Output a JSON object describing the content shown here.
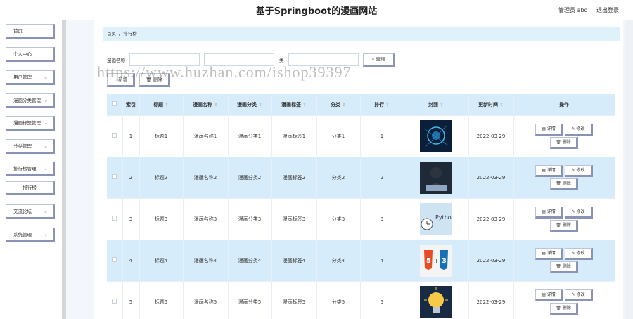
{
  "header": {
    "title": "基于Springboot的漫画网站",
    "user": "管理员 abo",
    "logout": "退出登录"
  },
  "sidebar": {
    "items": [
      {
        "label": "首页",
        "has_chevron": false
      },
      {
        "label": "个人中心",
        "has_chevron": false
      },
      {
        "label": "用户管理",
        "has_chevron": true
      },
      {
        "label": "漫画分类管理",
        "has_chevron": true
      },
      {
        "label": "漫画标签管理",
        "has_chevron": true
      },
      {
        "label": "分类管理",
        "has_chevron": true
      },
      {
        "label": "排行榜管理",
        "has_chevron": true
      },
      {
        "label": "排行榜",
        "sub": true
      },
      {
        "label": "交流论坛",
        "has_chevron": true
      },
      {
        "label": "系统管理",
        "has_chevron": true
      }
    ]
  },
  "breadcrumb": {
    "home": "首页",
    "sep": "/",
    "current": "排行榜"
  },
  "search": {
    "label1": "漫画名称",
    "label2": "类",
    "button": "查询"
  },
  "actions": {
    "add": "+ 新增",
    "delete": "删除"
  },
  "table": {
    "headers": [
      "",
      "索引",
      "标题",
      "漫画名称",
      "漫画分类",
      "漫画标签",
      "分类",
      "排行",
      "封面",
      "更新时间",
      "操作"
    ],
    "rows": [
      {
        "index": "1",
        "title": "标题1",
        "name": "漫画名称1",
        "category": "漫画分类1",
        "tag": "漫画标签1",
        "class": "分类1",
        "rank": "1",
        "date": "2022-03-29",
        "cover": "ai-brain"
      },
      {
        "index": "2",
        "title": "标题2",
        "name": "漫画名称2",
        "category": "漫画分类2",
        "tag": "漫画标签2",
        "class": "分类2",
        "rank": "2",
        "date": "2022-03-29",
        "cover": "hacker"
      },
      {
        "index": "3",
        "title": "标题3",
        "name": "漫画名称3",
        "category": "漫画分类3",
        "tag": "漫画标签3",
        "class": "分类3",
        "rank": "3",
        "date": "2022-03-29",
        "cover": "python"
      },
      {
        "index": "4",
        "title": "标题4",
        "name": "漫画名称4",
        "category": "漫画分类4",
        "tag": "漫画标签4",
        "class": "分类4",
        "rank": "4",
        "date": "2022-03-29",
        "cover": "html-css"
      },
      {
        "index": "5",
        "title": "标题5",
        "name": "漫画名称5",
        "category": "漫画分类5",
        "tag": "漫画标签5",
        "class": "分类5",
        "rank": "5",
        "date": "2022-03-29",
        "cover": "bulb"
      }
    ],
    "op_detail": "详情",
    "op_edit": "修改",
    "op_delete": "删除"
  },
  "watermark": "https://www.huzhan.com/ishop39397"
}
